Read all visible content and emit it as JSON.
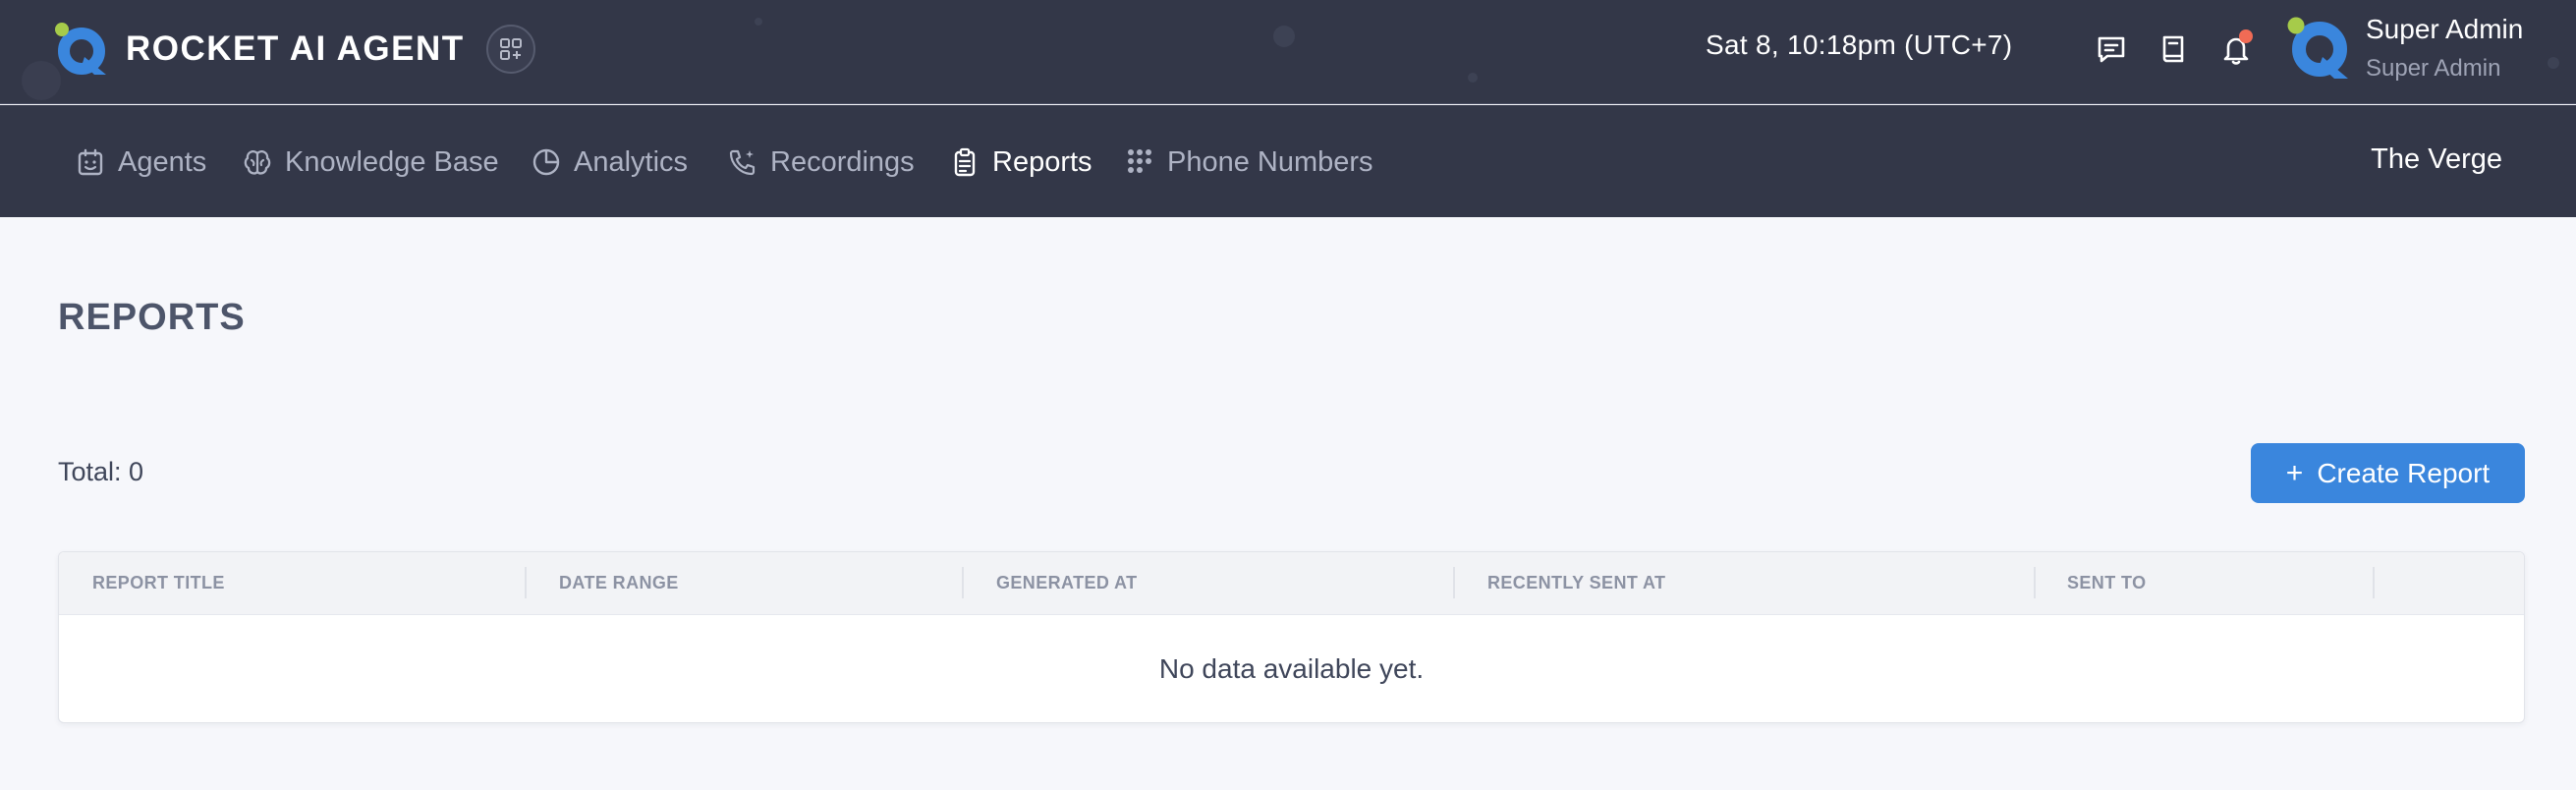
{
  "brand": {
    "name": "ROCKET AI AGENT"
  },
  "header": {
    "datetime": "Sat 8, 10:18pm (UTC+7)",
    "user_name": "Super Admin",
    "user_role": "Super Admin",
    "icons": [
      "chat-icon",
      "book-icon",
      "bell-icon"
    ]
  },
  "nav": {
    "items": [
      {
        "label": "Agents",
        "icon": "calendar-face-icon",
        "active": false
      },
      {
        "label": "Knowledge Base",
        "icon": "brain-icon",
        "active": false
      },
      {
        "label": "Analytics",
        "icon": "pie-chart-icon",
        "active": false
      },
      {
        "label": "Recordings",
        "icon": "phone-sparkle-icon",
        "active": false
      },
      {
        "label": "Reports",
        "icon": "clipboard-icon",
        "active": true
      },
      {
        "label": "Phone Numbers",
        "icon": "dialpad-icon",
        "active": false
      }
    ],
    "organization": "The Verge"
  },
  "page": {
    "title": "REPORTS",
    "total": "Total: 0",
    "create_button": "Create Report"
  },
  "table": {
    "columns": [
      "REPORT TITLE",
      "DATE RANGE",
      "GENERATED AT",
      "RECENTLY SENT AT",
      "SENT TO"
    ],
    "rows": [],
    "empty_message": "No data available yet."
  },
  "colors": {
    "header_bg": "#333748",
    "accent": "#3a86dd",
    "logo_blue": "#3a86dd",
    "logo_green": "#a6cb4a",
    "notification": "#f06b55",
    "page_bg": "#f6f7fb"
  }
}
